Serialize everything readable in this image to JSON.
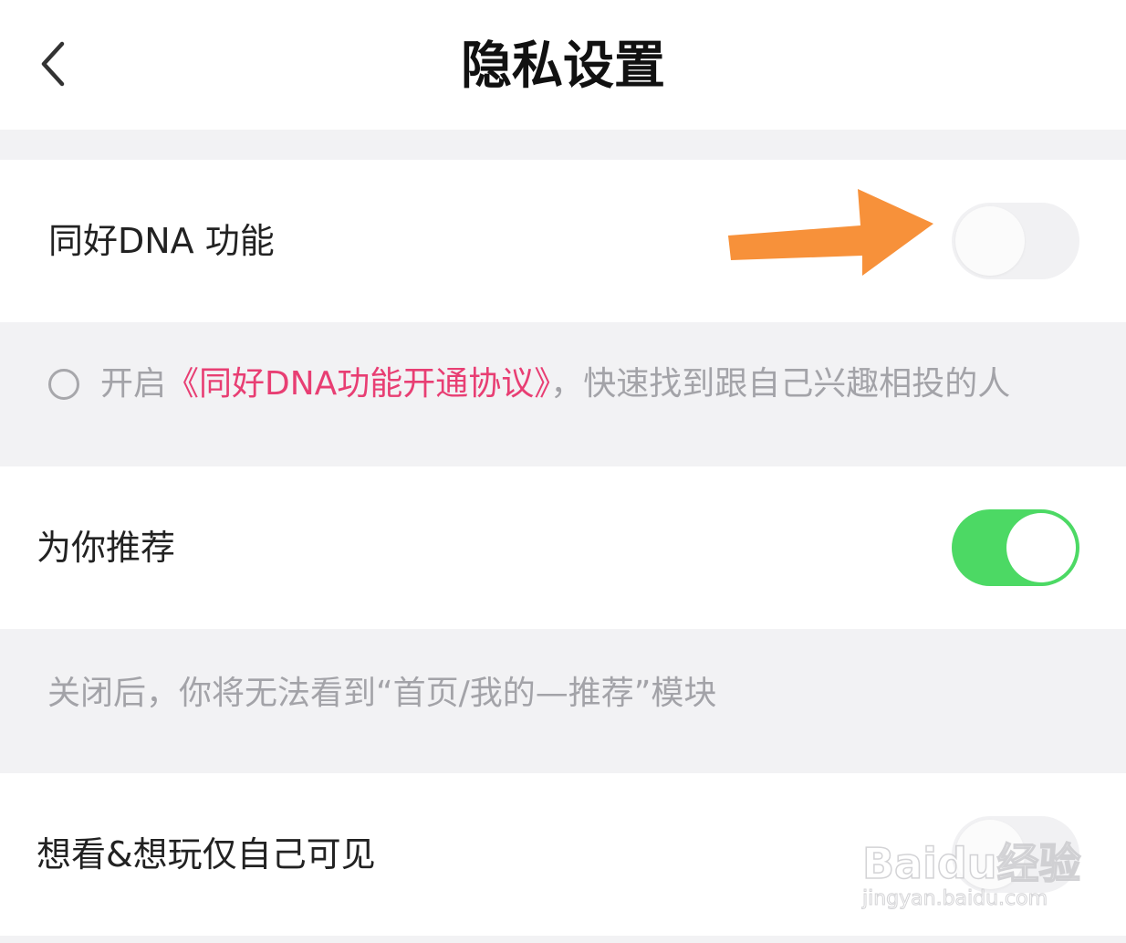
{
  "header": {
    "title": "隐私设置"
  },
  "settings": {
    "dna": {
      "label": "同好DNA 功能",
      "enabled": false,
      "hint_prefix": "开启",
      "hint_link": "《同好DNA功能开通协议》",
      "hint_suffix": "，快速找到跟自己兴趣相投的人"
    },
    "recommend": {
      "label": "为你推荐",
      "enabled": true,
      "hint": "关闭后，你将无法看到“首页/我的—推荐”模块"
    },
    "wishlist": {
      "label": "想看&想玩仅自己可见",
      "enabled": false
    }
  },
  "colors": {
    "toggle_on": "#4cd964",
    "link": "#e83e73",
    "arrow": "#f7913a"
  },
  "watermark": {
    "logo": "Baidu经验",
    "url": "jingyan.baidu.com"
  }
}
